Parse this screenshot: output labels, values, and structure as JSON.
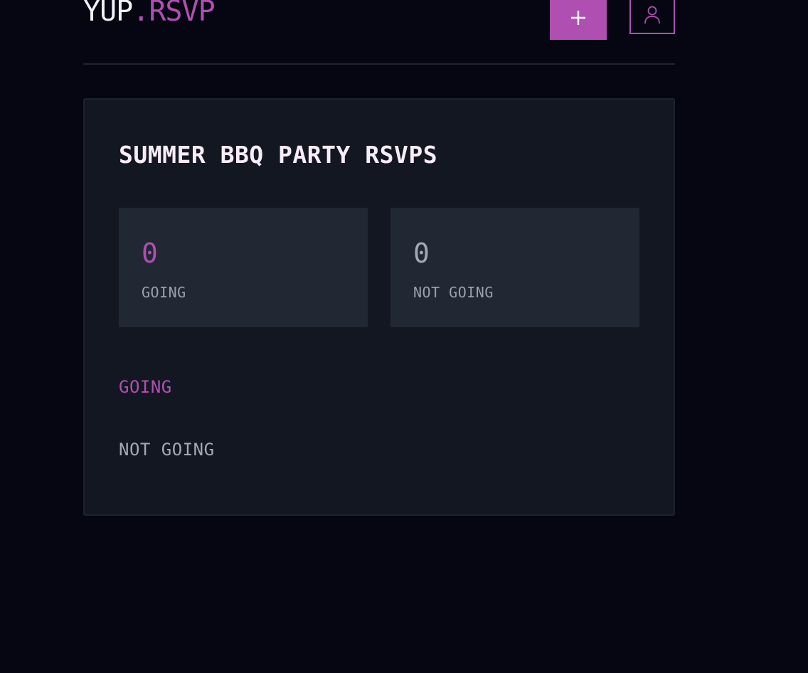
{
  "header": {
    "logo_main": "YUP",
    "logo_dot": ".",
    "logo_accent": "RSVP",
    "new_button_icon": "plus-icon",
    "user_button_icon": "user-icon"
  },
  "event": {
    "title": "SUMMER BBQ PARTY RSVPS",
    "stats": {
      "going_count": "0",
      "going_label": "GOING",
      "not_going_count": "0",
      "not_going_label": "NOT GOING"
    },
    "sections": {
      "going_heading": "GOING",
      "not_going_heading": "NOT GOING"
    }
  },
  "colors": {
    "background": "#050611",
    "card": "#131722",
    "stat_box": "#212733",
    "accent": "#b04fb2",
    "muted_text": "#a3a8b6"
  }
}
